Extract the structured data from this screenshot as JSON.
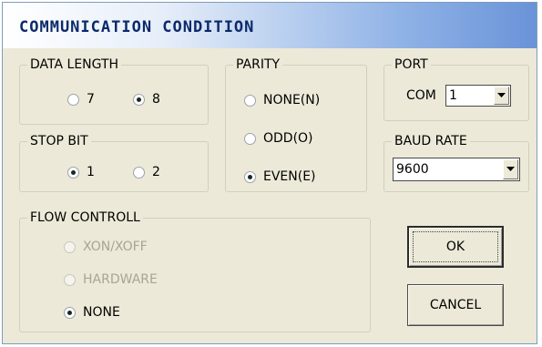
{
  "window": {
    "title": "COMMUNICATION CONDITION"
  },
  "data_length": {
    "legend": "DATA LENGTH",
    "options": [
      {
        "label": "7",
        "checked": false
      },
      {
        "label": "8",
        "checked": true
      }
    ]
  },
  "stop_bit": {
    "legend": "STOP BIT",
    "options": [
      {
        "label": "1",
        "checked": true
      },
      {
        "label": "2",
        "checked": false
      }
    ]
  },
  "parity": {
    "legend": "PARITY",
    "options": [
      {
        "label": "NONE(N)",
        "checked": false
      },
      {
        "label": "ODD(O)",
        "checked": false
      },
      {
        "label": "EVEN(E)",
        "checked": true
      }
    ]
  },
  "port": {
    "legend": "PORT",
    "prefix": "COM",
    "value": "1"
  },
  "baud_rate": {
    "legend": "BAUD RATE",
    "value": "9600"
  },
  "flow_control": {
    "legend": "FLOW CONTROLL",
    "options": [
      {
        "label": "XON/XOFF",
        "checked": false,
        "enabled": false
      },
      {
        "label": "HARDWARE",
        "checked": false,
        "enabled": false
      },
      {
        "label": "NONE",
        "checked": true,
        "enabled": true
      }
    ]
  },
  "buttons": {
    "ok": "OK",
    "cancel": "CANCEL"
  }
}
